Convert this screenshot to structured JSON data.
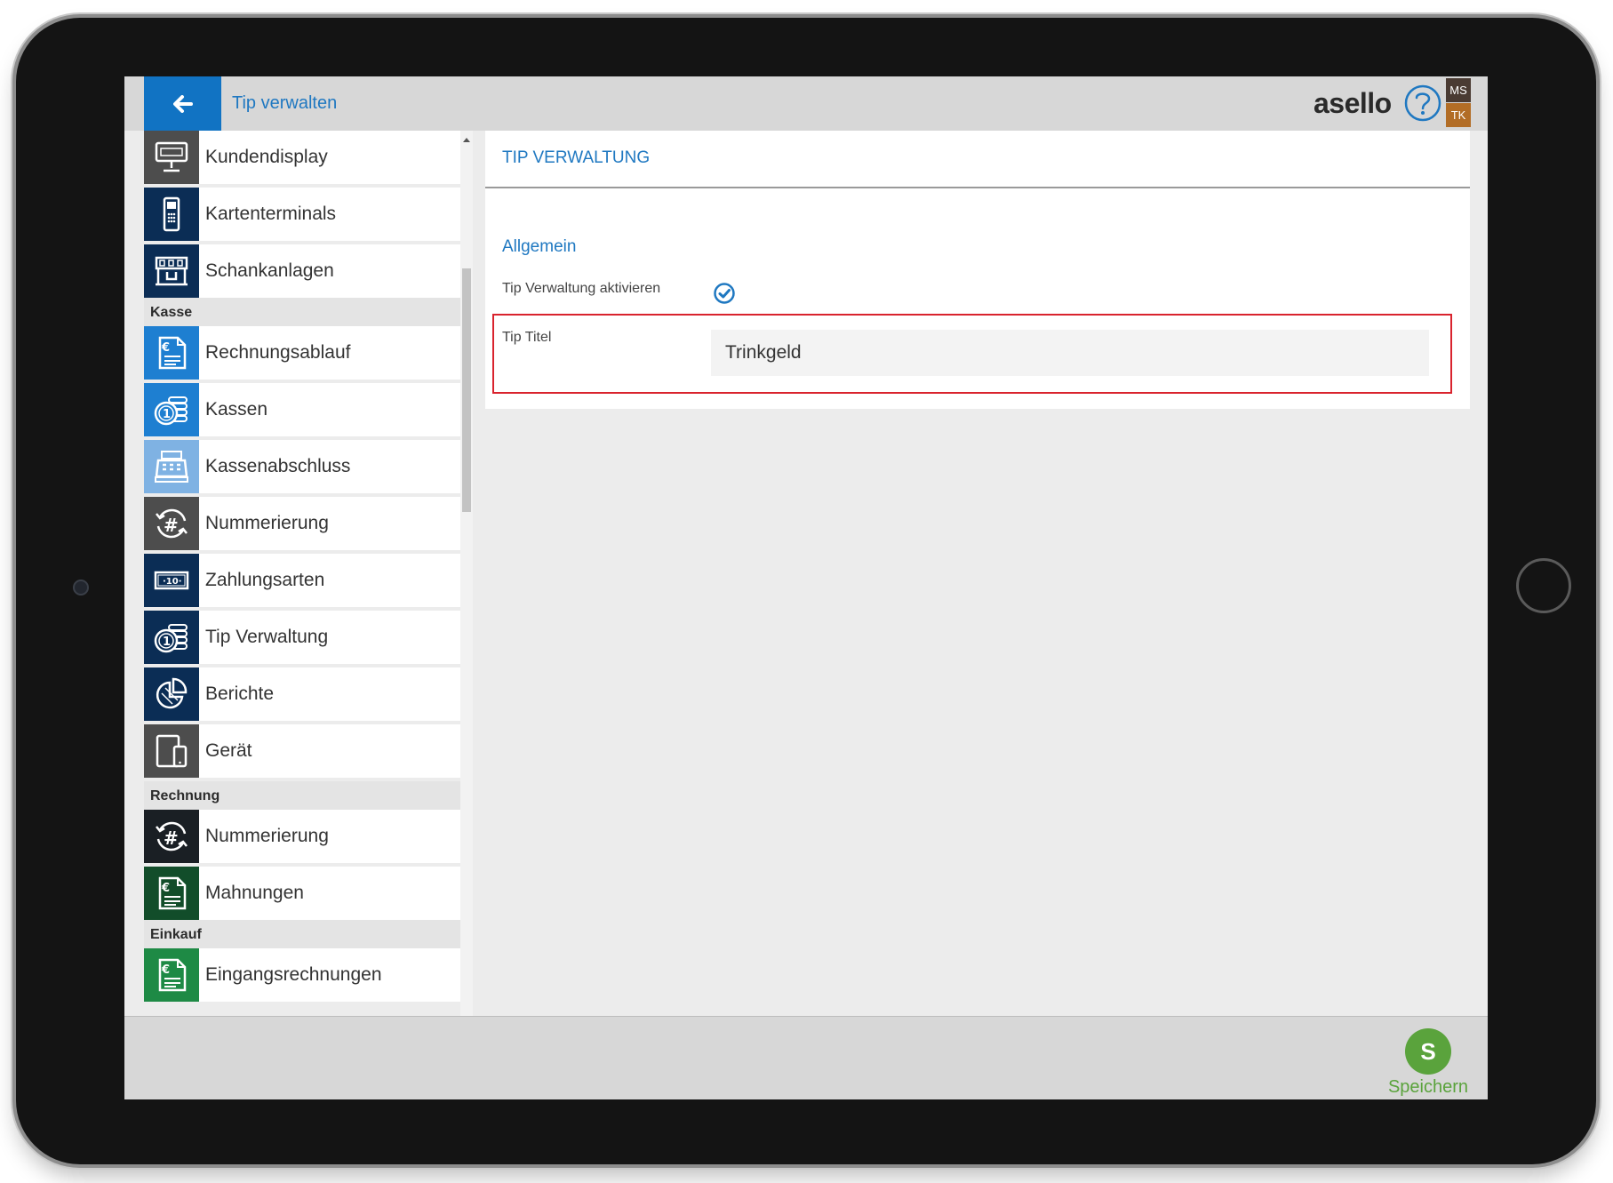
{
  "header": {
    "title": "Tip verwalten",
    "logo": "asello",
    "badge_top": "MS",
    "badge_bottom": "TK"
  },
  "sidebar": {
    "items": [
      {
        "label": "Kundendisplay",
        "icon": "customer-display-icon",
        "color": "#4d4d4d"
      },
      {
        "label": "Kartenterminals",
        "icon": "card-terminal-icon",
        "color": "#0b2d55"
      },
      {
        "label": "Schankanlagen",
        "icon": "tap-system-icon",
        "color": "#0b2d55"
      },
      {
        "label": "Rechnungsablauf",
        "icon": "invoice-flow-icon",
        "color": "#1e7fd1"
      },
      {
        "label": "Kassen",
        "icon": "coins-icon",
        "color": "#1e7fd1"
      },
      {
        "label": "Kassenabschluss",
        "icon": "cash-register-icon",
        "color": "#7fb2e3"
      },
      {
        "label": "Nummerierung",
        "icon": "numbering-icon",
        "color": "#4d4d4d"
      },
      {
        "label": "Zahlungsarten",
        "icon": "banknote-icon",
        "color": "#0b2d55"
      },
      {
        "label": "Tip Verwaltung",
        "icon": "coins-icon",
        "color": "#0b2d55"
      },
      {
        "label": "Berichte",
        "icon": "pie-chart-icon",
        "color": "#0b2d55"
      },
      {
        "label": "Gerät",
        "icon": "devices-icon",
        "color": "#4d4d4d"
      },
      {
        "label": "Nummerierung",
        "icon": "numbering-icon",
        "color": "#1a1f24"
      },
      {
        "label": "Mahnungen",
        "icon": "invoice-icon",
        "color": "#124d2a"
      },
      {
        "label": "Eingangsrechnungen",
        "icon": "invoice-icon",
        "color": "#1e8a45"
      }
    ],
    "sections": [
      "Kasse",
      "Rechnung",
      "Einkauf"
    ]
  },
  "panel": {
    "title": "TIP VERWALTUNG",
    "section": "Allgemein",
    "activate_label": "Tip Verwaltung aktivieren",
    "activate_checked": true,
    "tip_title_label": "Tip Titel",
    "tip_title_value": "Trinkgeld"
  },
  "footer": {
    "save_icon_letter": "S",
    "save_label": "Speichern"
  },
  "colors": {
    "accent": "#1f78c1",
    "header_bg": "#d7d7d7",
    "back_button": "#1173c3",
    "save_green": "#5aa33c",
    "highlight_red": "#d9232d"
  }
}
